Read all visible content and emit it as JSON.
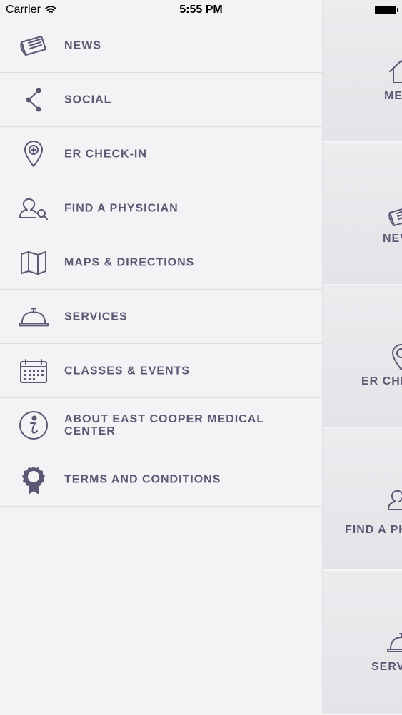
{
  "status_bar": {
    "carrier": "Carrier",
    "time": "5:55 PM"
  },
  "menu": {
    "items": [
      {
        "label": "NEWS",
        "icon": "newspaper-icon"
      },
      {
        "label": "SOCIAL",
        "icon": "share-icon"
      },
      {
        "label": "ER CHECK-IN",
        "icon": "location-pin-plus-icon"
      },
      {
        "label": "FIND A PHYSICIAN",
        "icon": "physician-search-icon"
      },
      {
        "label": "MAPS & DIRECTIONS",
        "icon": "map-icon"
      },
      {
        "label": "SERVICES",
        "icon": "service-bell-icon"
      },
      {
        "label": "CLASSES & EVENTS",
        "icon": "calendar-icon"
      },
      {
        "label": "ABOUT EAST COOPER MEDICAL CENTER",
        "icon": "info-icon"
      },
      {
        "label": "TERMS AND CONDITIONS",
        "icon": "ribbon-icon"
      }
    ]
  },
  "tiles": [
    {
      "label": "ME",
      "icon": "home-icon"
    },
    {
      "label": "NEV",
      "icon": "newspaper-icon"
    },
    {
      "label": "ER CHE",
      "icon": "location-pin-icon"
    },
    {
      "label": "FIND A PH",
      "icon": "physician-icon"
    },
    {
      "label": "SERV",
      "icon": "service-bell-icon"
    }
  ],
  "colors": {
    "text": "#5a5873",
    "background": "#f3f3f5"
  }
}
